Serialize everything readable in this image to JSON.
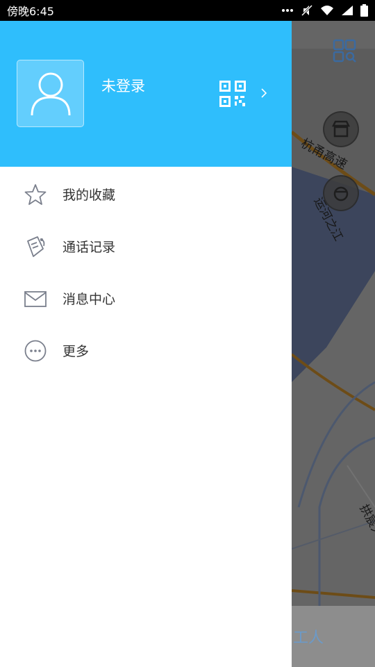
{
  "status_bar": {
    "time": "傍晚6:45"
  },
  "drawer": {
    "user": {
      "name": "未登录"
    },
    "menu": [
      {
        "label": "我的收藏",
        "icon": "star-icon"
      },
      {
        "label": "通话记录",
        "icon": "call-record-icon"
      },
      {
        "label": "消息中心",
        "icon": "mail-icon"
      },
      {
        "label": "更多",
        "icon": "more-icon"
      }
    ]
  },
  "map": {
    "road_labels": [
      "杭甬高速",
      "运河之江",
      "拱宸大道"
    ],
    "bottom_text": "工人"
  },
  "colors": {
    "header_bg": "#2fbefc",
    "text": "#333333",
    "icon": "#7a7f8c"
  }
}
